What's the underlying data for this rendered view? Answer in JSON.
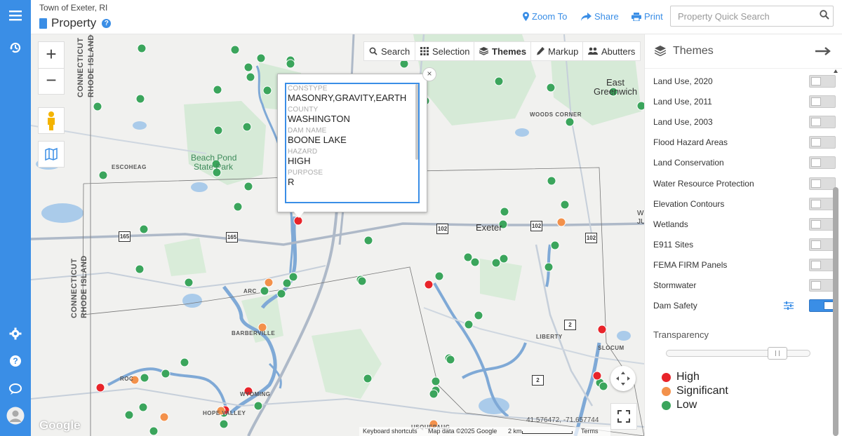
{
  "header": {
    "org": "Town of Exeter, RI",
    "title": "Property",
    "zoom_label": "Zoom To",
    "share_label": "Share",
    "print_label": "Print",
    "search_placeholder": "Property Quick Search"
  },
  "toolbar": {
    "search": "Search",
    "selection": "Selection",
    "themes": "Themes",
    "markup": "Markup",
    "abutters": "Abutters"
  },
  "popup": {
    "fields": [
      {
        "label": "CONSTYPE",
        "value": "MASONRY,GRAVITY,EARTH"
      },
      {
        "label": "COUNTY",
        "value": "WASHINGTON"
      },
      {
        "label": "DAM NAME",
        "value": "BOONE LAKE"
      },
      {
        "label": "HAZARD",
        "value": "HIGH"
      },
      {
        "label": "PURPOSE",
        "value": "R"
      }
    ],
    "close": "×"
  },
  "map_labels": {
    "ct_ri_1": "CONNECTICUT",
    "ct_ri_2": "RHODE ISLAND",
    "ct_ri_3": "CONNECTICUT",
    "ct_ri_4": "RHODE ISLAND",
    "beach_pond_1": "Beach Pond",
    "beach_pond_2": "State Park",
    "escoheag": "ESCOHEAG",
    "exeter": "Exeter",
    "east_greenwich_1": "East",
    "east_greenwich_2": "Greenwich",
    "woods_corner": "WOODS CORNER",
    "arcadia": "ARC",
    "barberville": "BARBERVILLE",
    "liberty": "LIBERTY",
    "slocum": "SLOCUM",
    "rockville": "ROC",
    "wyoming": "WYOMING",
    "hope_valley": "HOPE VALLEY",
    "usquepaug": "USQUEPAUG",
    "wj": "W",
    "wj2": "JU",
    "google": "Google",
    "r165a": "165",
    "r165b": "165",
    "r102a": "102",
    "r102b": "102",
    "r102c": "102",
    "r2a": "2",
    "r2b": "2"
  },
  "map_footer": {
    "coords": "41.576472, -71.657744",
    "shortcuts": "Keyboard shortcuts",
    "mapdata": "Map data ©2025 Google",
    "scale": "2 km",
    "terms": "Terms"
  },
  "themes_panel": {
    "title": "Themes",
    "layers": [
      {
        "label": "Land Use, 2020",
        "on": false
      },
      {
        "label": "Land Use, 2011",
        "on": false
      },
      {
        "label": "Land Use, 2003",
        "on": false
      },
      {
        "label": "Flood Hazard Areas",
        "on": false
      },
      {
        "label": "Land Conservation",
        "on": false
      },
      {
        "label": "Water Resource Protection",
        "on": false
      },
      {
        "label": "Elevation Contours",
        "on": false
      },
      {
        "label": "Wetlands",
        "on": false
      },
      {
        "label": "E911 Sites",
        "on": false
      },
      {
        "label": "FEMA FIRM Panels",
        "on": false
      },
      {
        "label": "Stormwater",
        "on": false
      },
      {
        "label": "Dam Safety",
        "on": true
      }
    ],
    "transparency_label": "Transparency",
    "transparency_value": 0.82,
    "legend": [
      {
        "label": "High",
        "color": "#e8242a"
      },
      {
        "label": "Significant",
        "color": "#f3914b"
      },
      {
        "label": "Low",
        "color": "#3ba55c"
      }
    ]
  },
  "colors": {
    "accent": "#3a8ee6",
    "high": "#e8242a",
    "significant": "#f3914b",
    "low": "#3ba55c",
    "water": "#a9cbe8",
    "park": "#cfe8d2"
  }
}
